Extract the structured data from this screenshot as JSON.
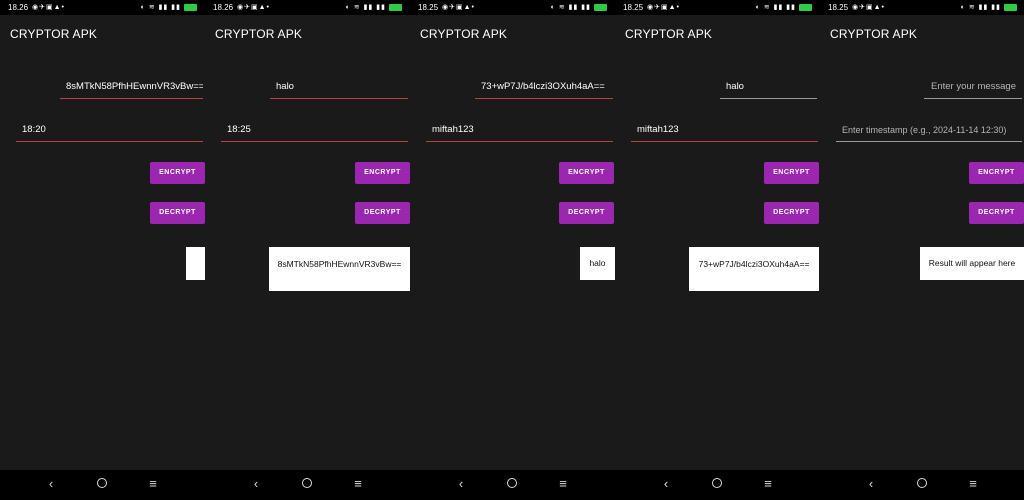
{
  "app": {
    "title": "CRYPTOR APK"
  },
  "buttons": {
    "encrypt": "ENCRYPT",
    "decrypt": "DECRYPT"
  },
  "nav": {
    "back": "‹",
    "menu": "≡"
  },
  "screens": [
    {
      "time": "18.26",
      "message_value": "8sMTkN58PfhHEwnnVR3vBw==",
      "timestamp_value": "18:20",
      "result": ""
    },
    {
      "time": "18.26",
      "message_value": "halo",
      "timestamp_value": "18:25",
      "result": "8sMTkN58PfhHEwnnVR3vBw=="
    },
    {
      "time": "18.25",
      "message_value": "73+wP7J/b4lczi3OXuh4aA==",
      "timestamp_value": "miftah123",
      "result": "halo"
    },
    {
      "time": "18.25",
      "message_value": "halo",
      "timestamp_value": "miftah123",
      "result": "73+wP7J/b4lczi3OXuh4aA=="
    },
    {
      "time": "18.25",
      "message_placeholder": "Enter your message",
      "timestamp_placeholder": "Enter timestamp (e.g., 2024-11-14 12:30)",
      "result": "Result will appear here"
    }
  ]
}
